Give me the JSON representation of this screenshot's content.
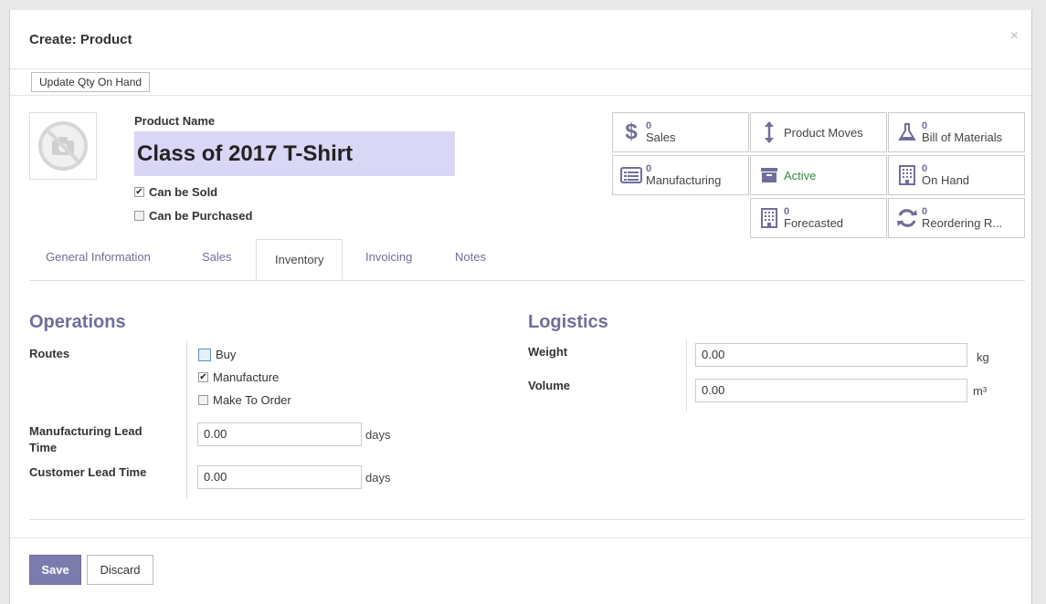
{
  "modal": {
    "title": "Create: Product",
    "close_glyph": "×"
  },
  "statusbar": {
    "update_qty_label": "Update Qty On Hand"
  },
  "product": {
    "name_label": "Product Name",
    "name_value": "Class of 2017 T-Shirt",
    "can_be_sold_label": "Can be Sold",
    "can_be_sold": true,
    "can_be_purchased_label": "Can be Purchased",
    "can_be_purchased": false,
    "image_icon": "camera-off-icon"
  },
  "smart_buttons": [
    {
      "icon": "dollar-icon",
      "count": "0",
      "label": "Sales"
    },
    {
      "icon": "arrows-vertical-icon",
      "count": "",
      "label": "Product Moves"
    },
    {
      "icon": "flask-icon",
      "count": "0",
      "label": "Bill of Materials"
    },
    {
      "icon": "list-icon",
      "count": "0",
      "label": "Manufacturing"
    },
    {
      "icon": "archive-icon",
      "count": "",
      "label": "Active"
    },
    {
      "icon": "building-icon",
      "count": "0",
      "label": "On Hand"
    },
    {
      "icon": "building-icon",
      "count": "0",
      "label": "Forecasted"
    },
    {
      "icon": "refresh-icon",
      "count": "0",
      "label": "Reordering R..."
    }
  ],
  "tabs": [
    "General Information",
    "Sales",
    "Inventory",
    "Invoicing",
    "Notes"
  ],
  "active_tab": "Inventory",
  "operations": {
    "title": "Operations",
    "routes_label": "Routes",
    "routes": [
      {
        "label": "Buy",
        "checked": false
      },
      {
        "label": "Manufacture",
        "checked": true
      },
      {
        "label": "Make To Order",
        "checked": false
      }
    ],
    "mfg_lead_label_line1": "Manufacturing Lead",
    "mfg_lead_label_line2": "Time",
    "mfg_lead_value": "0.00",
    "mfg_lead_unit": "days",
    "customer_lead_label": "Customer Lead Time",
    "customer_lead_value": "0.00",
    "customer_lead_unit": "days"
  },
  "logistics": {
    "title": "Logistics",
    "weight_label": "Weight",
    "weight_value": "0.00",
    "weight_unit": "kg",
    "volume_label": "Volume",
    "volume_value": "0.00",
    "volume_unit": "m³"
  },
  "footer": {
    "save_label": "Save",
    "discard_label": "Discard"
  },
  "colors": {
    "accent": "#6f6e9a",
    "name_field_bg": "#d9d7f5",
    "active_green": "#3c8a3c"
  }
}
